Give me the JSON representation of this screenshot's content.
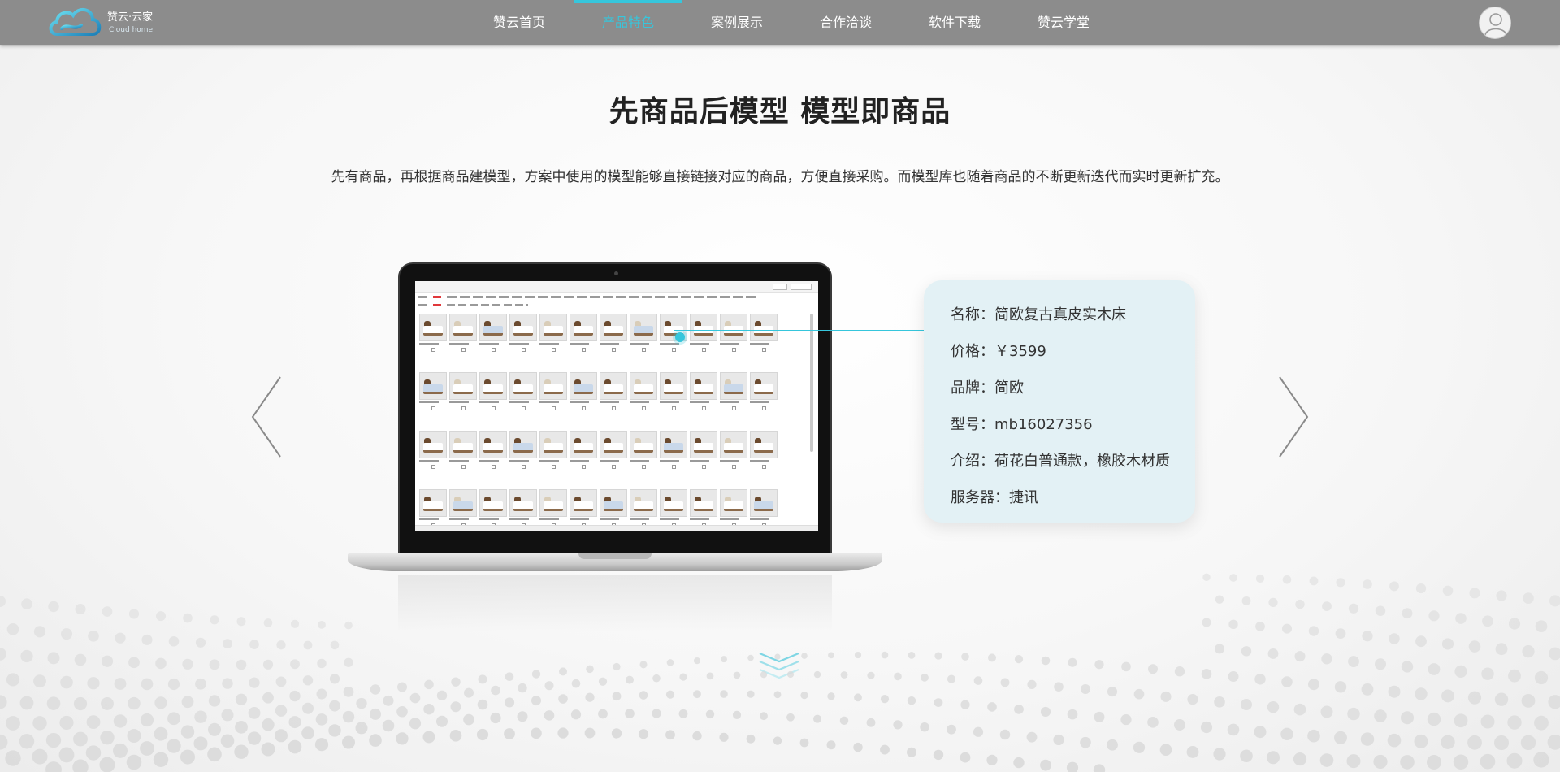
{
  "brand": {
    "name": "赞云·云家",
    "subtitle": "Cloud home",
    "accent_color": "#36c6dc"
  },
  "nav": {
    "items": [
      {
        "label": "赞云首页",
        "active": false
      },
      {
        "label": "产品特色",
        "active": true
      },
      {
        "label": "案例展示",
        "active": false
      },
      {
        "label": "合作洽谈",
        "active": false
      },
      {
        "label": "软件下载",
        "active": false
      },
      {
        "label": "赞云学堂",
        "active": false
      }
    ],
    "avatar_icon": "user-icon"
  },
  "hero": {
    "title": "先商品后模型 模型即商品",
    "subtitle": "先有商品，再根据商品建模型，方案中使用的模型能够直接链接对应的商品，方便直接采购。而模型库也随着商品的不断更新迭代而实时更新扩充。"
  },
  "carousel": {
    "prev_icon": "chevron-left-icon",
    "next_icon": "chevron-right-icon"
  },
  "product_info": {
    "name": "名称：简欧复古真皮实木床",
    "price": "价格：￥3599",
    "brand": "品牌：简欧",
    "model": "型号：mb16027356",
    "intro": "介绍：荷花白普通款，橡胶木材质",
    "server": "服务器：捷讯"
  },
  "scroll_icon": "chevrons-down-icon"
}
